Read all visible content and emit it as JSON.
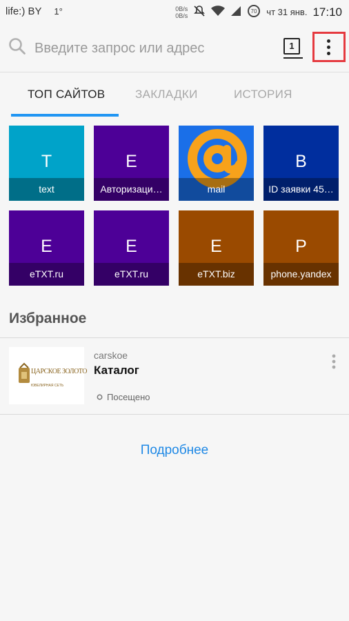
{
  "statusbar": {
    "carrier": "life:) BY",
    "signal_extra": "1°",
    "net_up": "0B/s",
    "net_down": "0B/s",
    "battery": "70",
    "date": "чт 31 янв.",
    "time": "17:10"
  },
  "toolbar": {
    "search_placeholder": "Введите запрос или адрес",
    "tabs_count": "1"
  },
  "page_tabs": [
    {
      "label": "ТОП САЙТОВ"
    },
    {
      "label": "ЗАКЛАДКИ"
    },
    {
      "label": "ИСТОРИЯ"
    }
  ],
  "top_sites": [
    {
      "letter": "T",
      "label": "text",
      "color": "#00a3c9"
    },
    {
      "letter": "E",
      "label": "Авторизаци…",
      "color": "#4d0097"
    },
    {
      "letter": "",
      "label": "mail",
      "color": "#1a6fe8",
      "icon": "mail-ru-at-logo"
    },
    {
      "letter": "B",
      "label": "ID заявки 45…",
      "color": "#002e9e"
    },
    {
      "letter": "E",
      "label": "eTXT.ru",
      "color": "#4d0097"
    },
    {
      "letter": "E",
      "label": "eTXT.ru",
      "color": "#4d0097"
    },
    {
      "letter": "E",
      "label": "eTXT.biz",
      "color": "#9a4a00"
    },
    {
      "letter": "P",
      "label": "phone.yandex",
      "color": "#9a4a00"
    }
  ],
  "favorites": {
    "heading": "Избранное",
    "items": [
      {
        "domain": "carskoe",
        "title": "Каталог",
        "status": "Посещено",
        "logo_text": "ЦАРСКОЕ ЗОЛОТО",
        "logo_subtext": "ЮВЕЛИРНАЯ СЕТЬ"
      }
    ],
    "more_label": "Подробнее"
  },
  "colors": {
    "accent": "#2196f3",
    "link": "#1e88e5",
    "highlight_box": "#e5393f"
  }
}
